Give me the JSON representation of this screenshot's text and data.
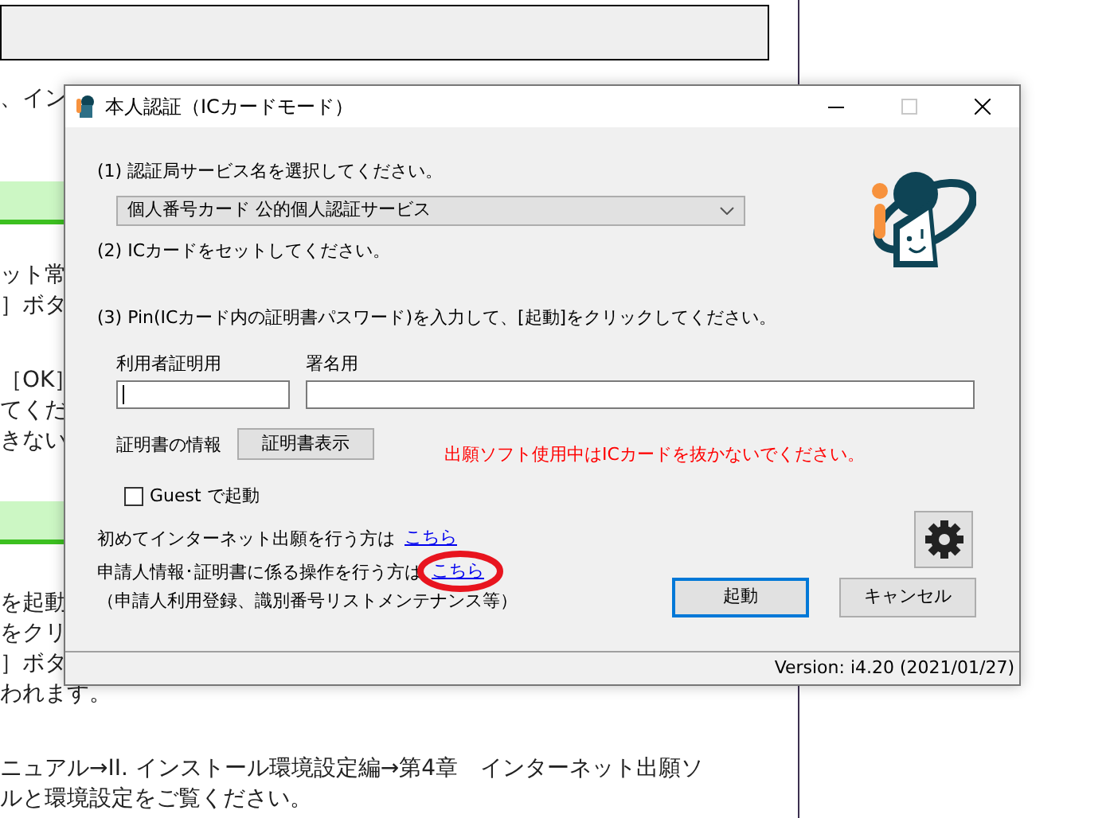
{
  "background": {
    "lines": [
      {
        "kind": "box"
      },
      {
        "kind": "text",
        "text": "、イン"
      },
      {
        "kind": "bar"
      },
      {
        "kind": "text",
        "text": "ット常"
      },
      {
        "kind": "text",
        "text": "］ボタ"
      },
      {
        "kind": "gap"
      },
      {
        "kind": "text",
        "text": "［OK］"
      },
      {
        "kind": "text",
        "text": "てくだ"
      },
      {
        "kind": "text",
        "text": "きない"
      },
      {
        "kind": "bar"
      },
      {
        "kind": "text",
        "text": "を起動"
      },
      {
        "kind": "text",
        "text": "をクリ"
      },
      {
        "kind": "text",
        "text": "］ボタ"
      },
      {
        "kind": "text",
        "text": "われます。"
      },
      {
        "kind": "gap"
      },
      {
        "kind": "text",
        "text": "ニュアル→II. インストール環境設定編→第4章　インターネット出願ソ"
      },
      {
        "kind": "text",
        "text": "ルと環境設定をご覧ください。"
      }
    ]
  },
  "dialog": {
    "title": "本人認証（ICカードモード）",
    "maximize": {
      "disabled": true
    },
    "step1": "(1)  認証局サービス名を選択してください。",
    "service_select": {
      "value": "個人番号カード  公的個人認証サービス"
    },
    "step2": "(2)  ICカードをセットしてください。",
    "step3": "(3)  Pin(ICカード内の証明書パスワード)を入力して、[起動]をクリックしてください。",
    "pin_fields": [
      {
        "label": "利用者証明用",
        "focused": true
      },
      {
        "label": "署名用",
        "focused": false
      }
    ],
    "cert_info": {
      "label": "証明書の情報",
      "button": "証明書表示"
    },
    "warning": "出願ソフト使用中はICカードを抜かないでください。",
    "guest": {
      "label": "Guest で起動",
      "checked": false
    },
    "links": [
      {
        "text": "初めてインターネット出願を行う方は",
        "link": "こちら",
        "circled": false
      },
      {
        "text": "申請人情報･証明書に係る操作を行う方は",
        "link": "こちら",
        "circled": true
      }
    ],
    "note": "（申請人利用登録、識別番号リストメンテナンス等）",
    "buttons": [
      {
        "label": "起動",
        "default": true
      },
      {
        "label": "キャンセル",
        "default": false
      }
    ],
    "version": "Version: i4.20 (2021/01/27)"
  }
}
